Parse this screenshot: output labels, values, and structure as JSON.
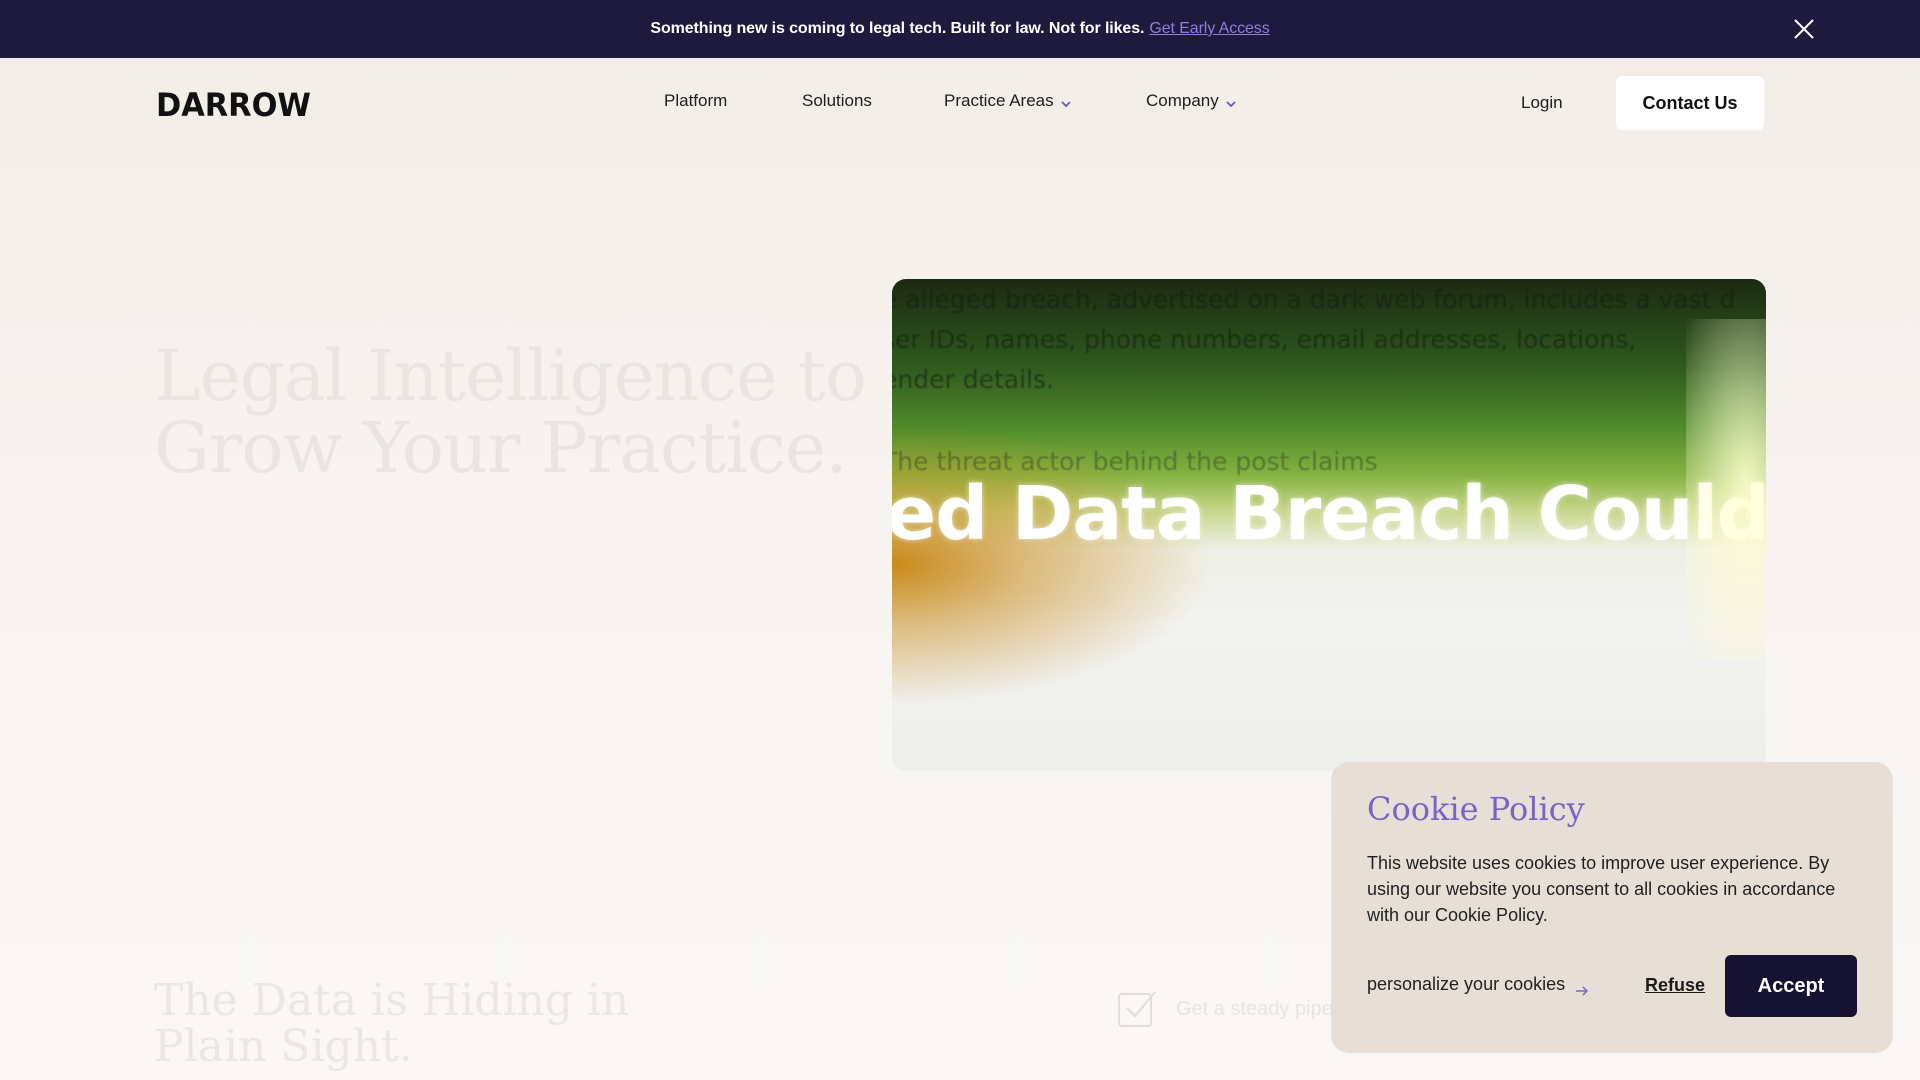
{
  "announcement": {
    "message": "Something new is coming to legal tech. Built for law. Not for likes.",
    "link_label": "Get Early Access",
    "close_icon": "close-icon"
  },
  "header": {
    "logo": "DARROW",
    "nav": [
      {
        "label": "Platform",
        "has_dropdown": false
      },
      {
        "label": "Solutions",
        "has_dropdown": false
      },
      {
        "label": "Practice Areas",
        "has_dropdown": true
      },
      {
        "label": "Company",
        "has_dropdown": true
      }
    ],
    "login_label": "Login",
    "contact_label": "Contact Us"
  },
  "hero": {
    "title_line1": "Legal Intelligence to",
    "title_line2": "Grow Your Practice.",
    "media": {
      "line1": "e alleged breach, advertised on a dark web forum, includes a vast d",
      "line2": "ser IDs, names, phone numbers, email addresses, locations,",
      "line3": "ender details.",
      "line4": "The threat actor behind the post claims",
      "headline": "ed Data Breach Could A"
    }
  },
  "section2": {
    "title_line1": "The Data is Hiding in",
    "title_line2": "Plain Sight.",
    "feature_text": "Get a steady pipe",
    "feature_icon": "checkbox-icon"
  },
  "cookie": {
    "title": "Cookie Policy",
    "body": "This website uses cookies to improve user experience. By using our website you consent to all cookies in accordance with our Cookie Policy.",
    "personalize_label": "personalize your cookies",
    "refuse_label": "Refuse",
    "accept_label": "Accept"
  },
  "colors": {
    "announcement_bg": "#1d1a3e",
    "accent_purple": "#7b62c9",
    "accept_bg": "#151232",
    "cookie_bg": "#e7dfd6"
  }
}
